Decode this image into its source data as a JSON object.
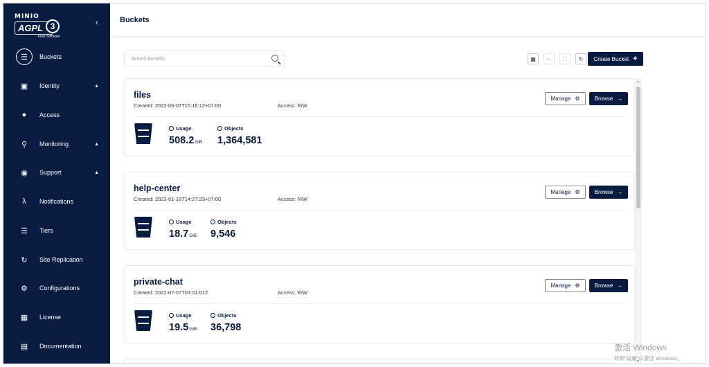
{
  "logo": {
    "brand": "MINIO",
    "license": "AGPL",
    "version": "3",
    "tagline": "Free Software"
  },
  "sidebar": {
    "collapse_icon": "chevron-left-icon",
    "items": [
      {
        "label": "Buckets",
        "icon": "bucket-icon",
        "active": true
      },
      {
        "label": "Identity",
        "icon": "id-card-icon",
        "expandable": true
      },
      {
        "label": "Access",
        "icon": "lock-icon"
      },
      {
        "label": "Monitoring",
        "icon": "search-icon",
        "expandable": true
      },
      {
        "label": "Support",
        "icon": "support-icon",
        "expandable": true
      },
      {
        "label": "Notifications",
        "icon": "lambda-icon"
      },
      {
        "label": "Tiers",
        "icon": "layers-icon"
      },
      {
        "label": "Site Replication",
        "icon": "replication-icon"
      },
      {
        "label": "Configurations",
        "icon": "gear-icon"
      },
      {
        "label": "License",
        "icon": "license-icon"
      },
      {
        "label": "Documentation",
        "icon": "documentation-icon"
      }
    ]
  },
  "header": {
    "title": "Buckets"
  },
  "toolbar": {
    "search_placeholder": "Search Buckets",
    "create_label": "Create Bucket"
  },
  "buckets": [
    {
      "name": "files",
      "created": "Created: 2022-06-07T15:16:12+07:00",
      "access": "Access: R/W",
      "usage_value": "508.2",
      "usage_unit": "GiB",
      "objects": "1,364,581"
    },
    {
      "name": "help-center",
      "created": "Created: 2023-01-16T14:27:29+07:00",
      "access": "Access: R/W",
      "usage_value": "18.7",
      "usage_unit": "GiB",
      "objects": "9,546"
    },
    {
      "name": "private-chat",
      "created": "Created: 2022-07-07T03:01:01Z",
      "access": "Access: R/W",
      "usage_value": "19.5",
      "usage_unit": "GiB",
      "objects": "36,798"
    }
  ],
  "labels": {
    "usage": "Usage",
    "objects": "Objects",
    "manage": "Manage",
    "browse": "Browse"
  },
  "watermark": {
    "line1": "激活 Windows",
    "line2": "转到\"设置\"以激活 Windows。"
  },
  "colors": {
    "sidebar_bg": "#081c42",
    "primary": "#081c42",
    "text": "#07193e"
  }
}
